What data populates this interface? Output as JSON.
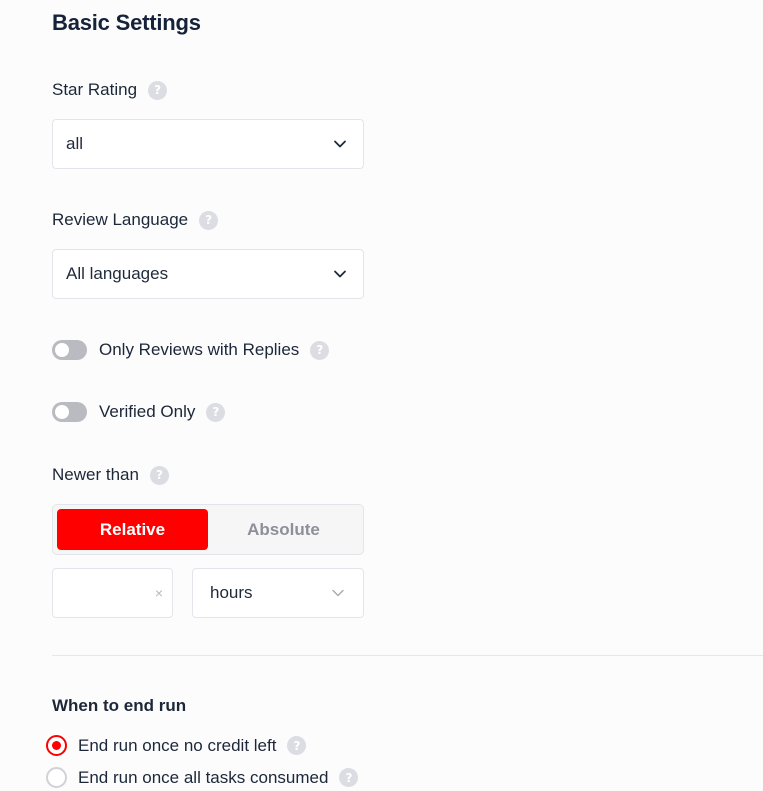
{
  "section": {
    "title": "Basic Settings"
  },
  "star_rating": {
    "label": "Star Rating",
    "help": "?",
    "selected": "all"
  },
  "review_language": {
    "label": "Review Language",
    "help": "?",
    "selected": "All languages"
  },
  "toggles": {
    "only_replies": {
      "label": "Only Reviews with Replies",
      "help": "?",
      "on": false
    },
    "verified_only": {
      "label": "Verified Only",
      "help": "?",
      "on": false
    }
  },
  "newer_than": {
    "label": "Newer than",
    "help": "?",
    "modes": {
      "relative": "Relative",
      "absolute": "Absolute",
      "active": "Relative"
    },
    "amount_value": "",
    "clear": "×",
    "unit": "hours"
  },
  "end_run": {
    "title": "When to end run",
    "options": [
      {
        "label": "End run once no credit left",
        "help": "?",
        "checked": true
      },
      {
        "label": "End run once all tasks consumed",
        "help": "?",
        "checked": false
      }
    ]
  },
  "colors": {
    "accent": "#ff0000",
    "text": "#1c2738",
    "border": "#e3e5ea"
  }
}
